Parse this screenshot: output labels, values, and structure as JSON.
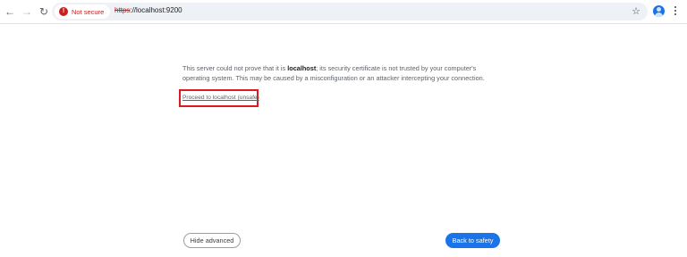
{
  "browser": {
    "security_chip": {
      "label": "Not secure",
      "icon": "warning-icon"
    },
    "url": {
      "scheme": "https",
      "rest": "://localhost:9200"
    },
    "toolbar_icons": [
      "back-arrow-icon",
      "forward-arrow-icon",
      "reload-icon",
      "bookmark-star-icon",
      "profile-icon",
      "menu-icon"
    ]
  },
  "content": {
    "message_part1": "This server could not prove that it is ",
    "message_bold": "localhost",
    "message_part2": "; its security certificate is not trusted by your computer's operating system. This may be caused by a misconfiguration or an attacker intercepting your connection.",
    "proceed_link": "Proceed to localhost (unsafe)"
  },
  "buttons": {
    "hide_advanced": "Hide advanced",
    "back_to_safety": "Back to safety"
  },
  "colors": {
    "accent": "#1a73e8",
    "danger": "#c5221f",
    "highlight_box": "#e0181f"
  }
}
